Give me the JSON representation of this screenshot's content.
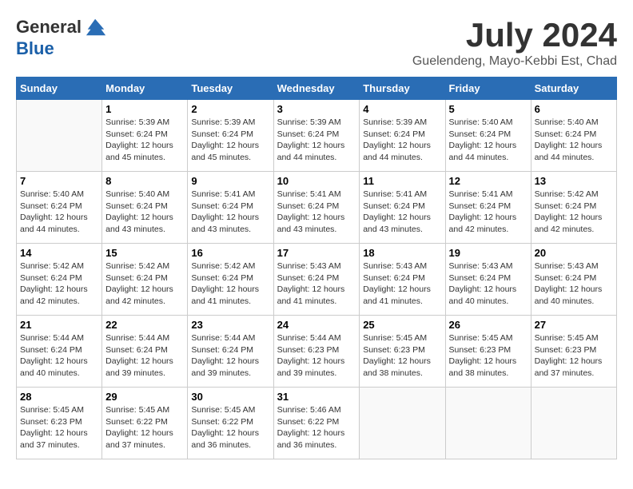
{
  "logo": {
    "general": "General",
    "blue": "Blue"
  },
  "header": {
    "month": "July 2024",
    "location": "Guelendeng, Mayo-Kebbi Est, Chad"
  },
  "weekdays": [
    "Sunday",
    "Monday",
    "Tuesday",
    "Wednesday",
    "Thursday",
    "Friday",
    "Saturday"
  ],
  "weeks": [
    [
      {
        "day": "",
        "info": ""
      },
      {
        "day": "1",
        "info": "Sunrise: 5:39 AM\nSunset: 6:24 PM\nDaylight: 12 hours\nand 45 minutes."
      },
      {
        "day": "2",
        "info": "Sunrise: 5:39 AM\nSunset: 6:24 PM\nDaylight: 12 hours\nand 45 minutes."
      },
      {
        "day": "3",
        "info": "Sunrise: 5:39 AM\nSunset: 6:24 PM\nDaylight: 12 hours\nand 44 minutes."
      },
      {
        "day": "4",
        "info": "Sunrise: 5:39 AM\nSunset: 6:24 PM\nDaylight: 12 hours\nand 44 minutes."
      },
      {
        "day": "5",
        "info": "Sunrise: 5:40 AM\nSunset: 6:24 PM\nDaylight: 12 hours\nand 44 minutes."
      },
      {
        "day": "6",
        "info": "Sunrise: 5:40 AM\nSunset: 6:24 PM\nDaylight: 12 hours\nand 44 minutes."
      }
    ],
    [
      {
        "day": "7",
        "info": "Sunrise: 5:40 AM\nSunset: 6:24 PM\nDaylight: 12 hours\nand 44 minutes."
      },
      {
        "day": "8",
        "info": "Sunrise: 5:40 AM\nSunset: 6:24 PM\nDaylight: 12 hours\nand 43 minutes."
      },
      {
        "day": "9",
        "info": "Sunrise: 5:41 AM\nSunset: 6:24 PM\nDaylight: 12 hours\nand 43 minutes."
      },
      {
        "day": "10",
        "info": "Sunrise: 5:41 AM\nSunset: 6:24 PM\nDaylight: 12 hours\nand 43 minutes."
      },
      {
        "day": "11",
        "info": "Sunrise: 5:41 AM\nSunset: 6:24 PM\nDaylight: 12 hours\nand 43 minutes."
      },
      {
        "day": "12",
        "info": "Sunrise: 5:41 AM\nSunset: 6:24 PM\nDaylight: 12 hours\nand 42 minutes."
      },
      {
        "day": "13",
        "info": "Sunrise: 5:42 AM\nSunset: 6:24 PM\nDaylight: 12 hours\nand 42 minutes."
      }
    ],
    [
      {
        "day": "14",
        "info": "Sunrise: 5:42 AM\nSunset: 6:24 PM\nDaylight: 12 hours\nand 42 minutes."
      },
      {
        "day": "15",
        "info": "Sunrise: 5:42 AM\nSunset: 6:24 PM\nDaylight: 12 hours\nand 42 minutes."
      },
      {
        "day": "16",
        "info": "Sunrise: 5:42 AM\nSunset: 6:24 PM\nDaylight: 12 hours\nand 41 minutes."
      },
      {
        "day": "17",
        "info": "Sunrise: 5:43 AM\nSunset: 6:24 PM\nDaylight: 12 hours\nand 41 minutes."
      },
      {
        "day": "18",
        "info": "Sunrise: 5:43 AM\nSunset: 6:24 PM\nDaylight: 12 hours\nand 41 minutes."
      },
      {
        "day": "19",
        "info": "Sunrise: 5:43 AM\nSunset: 6:24 PM\nDaylight: 12 hours\nand 40 minutes."
      },
      {
        "day": "20",
        "info": "Sunrise: 5:43 AM\nSunset: 6:24 PM\nDaylight: 12 hours\nand 40 minutes."
      }
    ],
    [
      {
        "day": "21",
        "info": "Sunrise: 5:44 AM\nSunset: 6:24 PM\nDaylight: 12 hours\nand 40 minutes."
      },
      {
        "day": "22",
        "info": "Sunrise: 5:44 AM\nSunset: 6:24 PM\nDaylight: 12 hours\nand 39 minutes."
      },
      {
        "day": "23",
        "info": "Sunrise: 5:44 AM\nSunset: 6:24 PM\nDaylight: 12 hours\nand 39 minutes."
      },
      {
        "day": "24",
        "info": "Sunrise: 5:44 AM\nSunset: 6:23 PM\nDaylight: 12 hours\nand 39 minutes."
      },
      {
        "day": "25",
        "info": "Sunrise: 5:45 AM\nSunset: 6:23 PM\nDaylight: 12 hours\nand 38 minutes."
      },
      {
        "day": "26",
        "info": "Sunrise: 5:45 AM\nSunset: 6:23 PM\nDaylight: 12 hours\nand 38 minutes."
      },
      {
        "day": "27",
        "info": "Sunrise: 5:45 AM\nSunset: 6:23 PM\nDaylight: 12 hours\nand 37 minutes."
      }
    ],
    [
      {
        "day": "28",
        "info": "Sunrise: 5:45 AM\nSunset: 6:23 PM\nDaylight: 12 hours\nand 37 minutes."
      },
      {
        "day": "29",
        "info": "Sunrise: 5:45 AM\nSunset: 6:22 PM\nDaylight: 12 hours\nand 37 minutes."
      },
      {
        "day": "30",
        "info": "Sunrise: 5:45 AM\nSunset: 6:22 PM\nDaylight: 12 hours\nand 36 minutes."
      },
      {
        "day": "31",
        "info": "Sunrise: 5:46 AM\nSunset: 6:22 PM\nDaylight: 12 hours\nand 36 minutes."
      },
      {
        "day": "",
        "info": ""
      },
      {
        "day": "",
        "info": ""
      },
      {
        "day": "",
        "info": ""
      }
    ]
  ]
}
